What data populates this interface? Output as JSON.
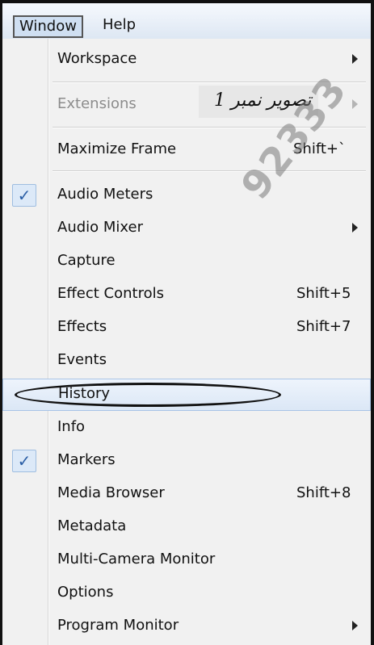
{
  "menubar": {
    "items": [
      {
        "label": "Window",
        "open": true
      },
      {
        "label": "Help",
        "open": false
      }
    ]
  },
  "menu": {
    "items": [
      {
        "label": "Workspace",
        "shortcut": "",
        "submenu": true,
        "checked": false,
        "disabled": false
      },
      {
        "label": "Extensions",
        "shortcut": "",
        "submenu": true,
        "checked": false,
        "disabled": true
      },
      {
        "label": "Maximize Frame",
        "shortcut": "Shift+`",
        "submenu": false,
        "checked": false,
        "disabled": false
      },
      {
        "label": "Audio Meters",
        "shortcut": "",
        "submenu": false,
        "checked": true,
        "disabled": false
      },
      {
        "label": "Audio Mixer",
        "shortcut": "",
        "submenu": true,
        "checked": false,
        "disabled": false
      },
      {
        "label": "Capture",
        "shortcut": "",
        "submenu": false,
        "checked": false,
        "disabled": false
      },
      {
        "label": "Effect Controls",
        "shortcut": "Shift+5",
        "submenu": false,
        "checked": false,
        "disabled": false
      },
      {
        "label": "Effects",
        "shortcut": "Shift+7",
        "submenu": false,
        "checked": false,
        "disabled": false
      },
      {
        "label": "Events",
        "shortcut": "",
        "submenu": false,
        "checked": false,
        "disabled": false
      },
      {
        "label": "History",
        "shortcut": "",
        "submenu": false,
        "checked": false,
        "disabled": false,
        "highlighted": true
      },
      {
        "label": "Info",
        "shortcut": "",
        "submenu": false,
        "checked": false,
        "disabled": false
      },
      {
        "label": "Markers",
        "shortcut": "",
        "submenu": false,
        "checked": true,
        "disabled": false
      },
      {
        "label": "Media Browser",
        "shortcut": "Shift+8",
        "submenu": false,
        "checked": false,
        "disabled": false
      },
      {
        "label": "Metadata",
        "shortcut": "",
        "submenu": false,
        "checked": false,
        "disabled": false
      },
      {
        "label": "Multi-Camera Monitor",
        "shortcut": "",
        "submenu": false,
        "checked": false,
        "disabled": false
      },
      {
        "label": "Options",
        "shortcut": "",
        "submenu": false,
        "checked": false,
        "disabled": false
      },
      {
        "label": "Program Monitor",
        "shortcut": "",
        "submenu": true,
        "checked": false,
        "disabled": false
      }
    ]
  },
  "overlay": {
    "caption": "تصویر نمبر 1",
    "watermark": "92333"
  },
  "icons": {
    "check": "check-icon",
    "submenu": "submenu-arrow-icon"
  },
  "colors": {
    "highlight": "#dbe7f6",
    "check": "#2c5fa6",
    "menubar": "#dde7f3"
  }
}
